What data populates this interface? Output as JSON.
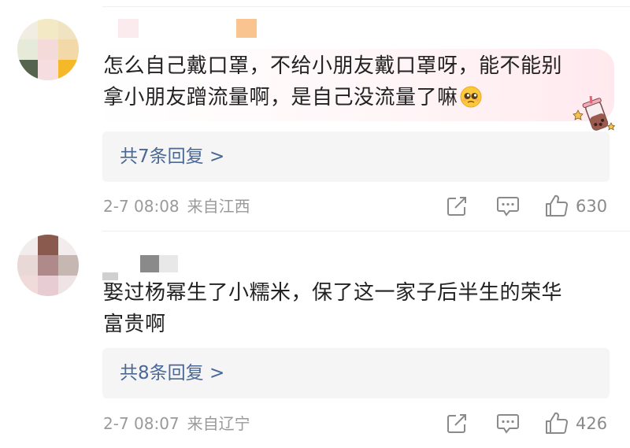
{
  "comments": [
    {
      "text_line1": "怎么自己戴口罩，不给小朋友戴口罩呀，能不能别",
      "text_line2": "拿小朋友蹭流量啊，是自己没流量了嘛",
      "replies_label": "共7条回复 >",
      "date": "2-7 08:08",
      "source": "来自江西",
      "like_count": "630"
    },
    {
      "text_line1": "娶过杨幂生了小糯米，保了这一家子后半生的荣华",
      "text_line2": "富贵啊",
      "replies_label": "共8条回复 >",
      "date": "2-7 08:07",
      "source": "来自辽宁",
      "like_count": "426"
    }
  ],
  "icons": {
    "share": "share-icon",
    "comment": "comment-icon",
    "like": "thumbs-up-icon",
    "emoji": "pleading-face-emoji",
    "sticker": "bubble-tea-sticker"
  },
  "colors": {
    "link": "#4a6896",
    "meta": "#9a9a9a",
    "text": "#222222",
    "replies_bg": "#f5f5f5"
  }
}
